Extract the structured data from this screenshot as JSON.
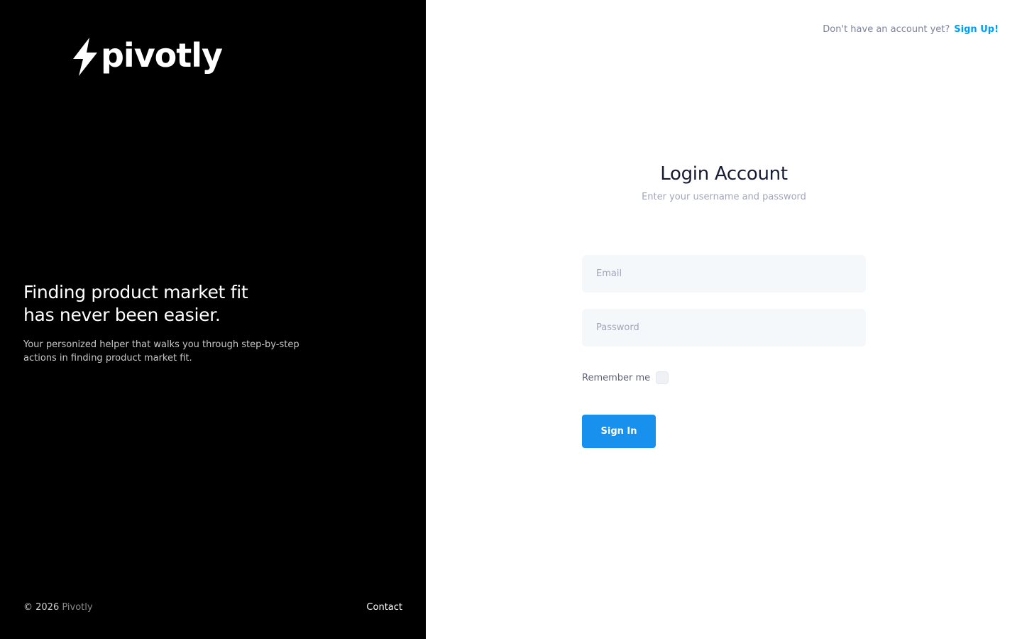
{
  "brand": {
    "logo_text": "pivotly",
    "logo_icon": "lightning-bolt-icon"
  },
  "left": {
    "tagline_line1": "Finding product market fit",
    "tagline_line2": "has never been easier.",
    "description": "Your personized helper that walks you through step-by-step actions in finding product market fit.",
    "footer_copy_prefix": "© 2026",
    "footer_copy_brand": "Pivotly",
    "contact_label": "Contact"
  },
  "header": {
    "signup_prompt": "Don't have an account yet?",
    "signup_label": "Sign Up!"
  },
  "form": {
    "title": "Login Account",
    "subtitle": "Enter your username and password",
    "email_placeholder": "Email",
    "email_value": "",
    "password_placeholder": "Password",
    "password_value": "",
    "remember_label": "Remember me",
    "remember_checked": false,
    "submit_label": "Sign In"
  },
  "colors": {
    "left_bg": "#000000",
    "accent": "#1890ee",
    "link": "#009ef7",
    "input_bg": "#f5f8fa"
  }
}
